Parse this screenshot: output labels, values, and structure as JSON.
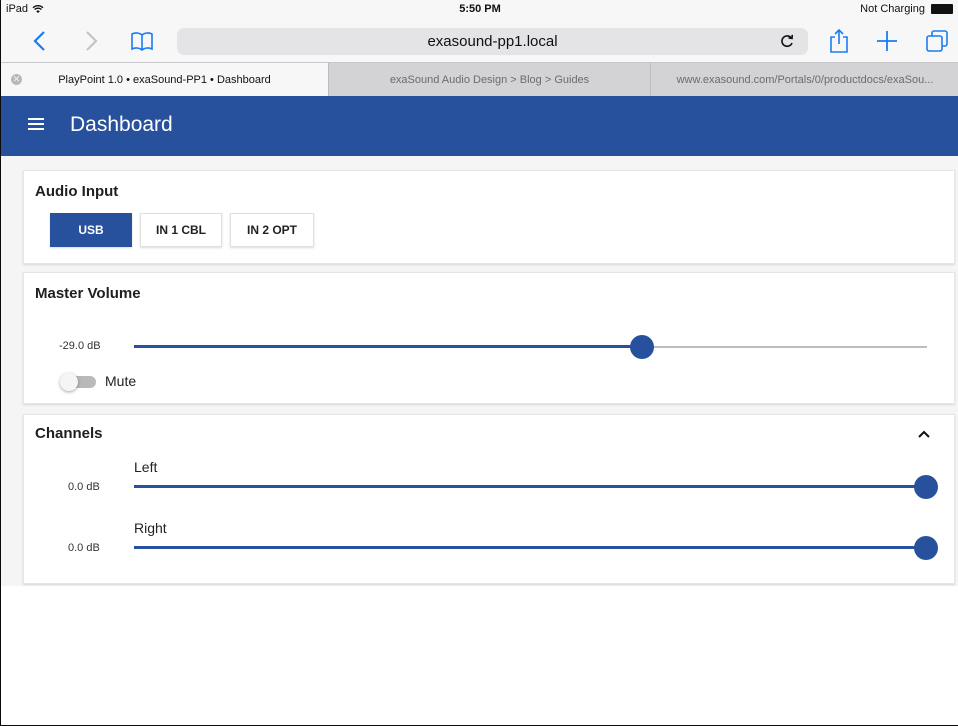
{
  "status_bar": {
    "device": "iPad",
    "time": "5:50 PM",
    "battery_text": "Not Charging"
  },
  "browser": {
    "url": "exasound-pp1.local",
    "tabs": [
      {
        "label": "PlayPoint 1.0 • exaSound-PP1 • Dashboard",
        "active": true
      },
      {
        "label": "exaSound Audio Design > Blog > Guides",
        "active": false
      },
      {
        "label": "www.exasound.com/Portals/0/productdocs/exaSou...",
        "active": false
      }
    ]
  },
  "app": {
    "title": "Dashboard",
    "accent": "#27519c"
  },
  "audio_input": {
    "title": "Audio Input",
    "options": [
      "USB",
      "IN 1 CBL",
      "IN 2 OPT"
    ],
    "selected": "USB"
  },
  "master_volume": {
    "title": "Master Volume",
    "value_label": "-29.0 dB",
    "level_fraction": 0.64,
    "mute_label": "Mute",
    "mute_on": false
  },
  "channels": {
    "title": "Channels",
    "expanded": true,
    "items": [
      {
        "name": "Left",
        "value_label": "0.0 dB",
        "level_fraction": 1.0
      },
      {
        "name": "Right",
        "value_label": "0.0 dB",
        "level_fraction": 1.0
      }
    ]
  }
}
